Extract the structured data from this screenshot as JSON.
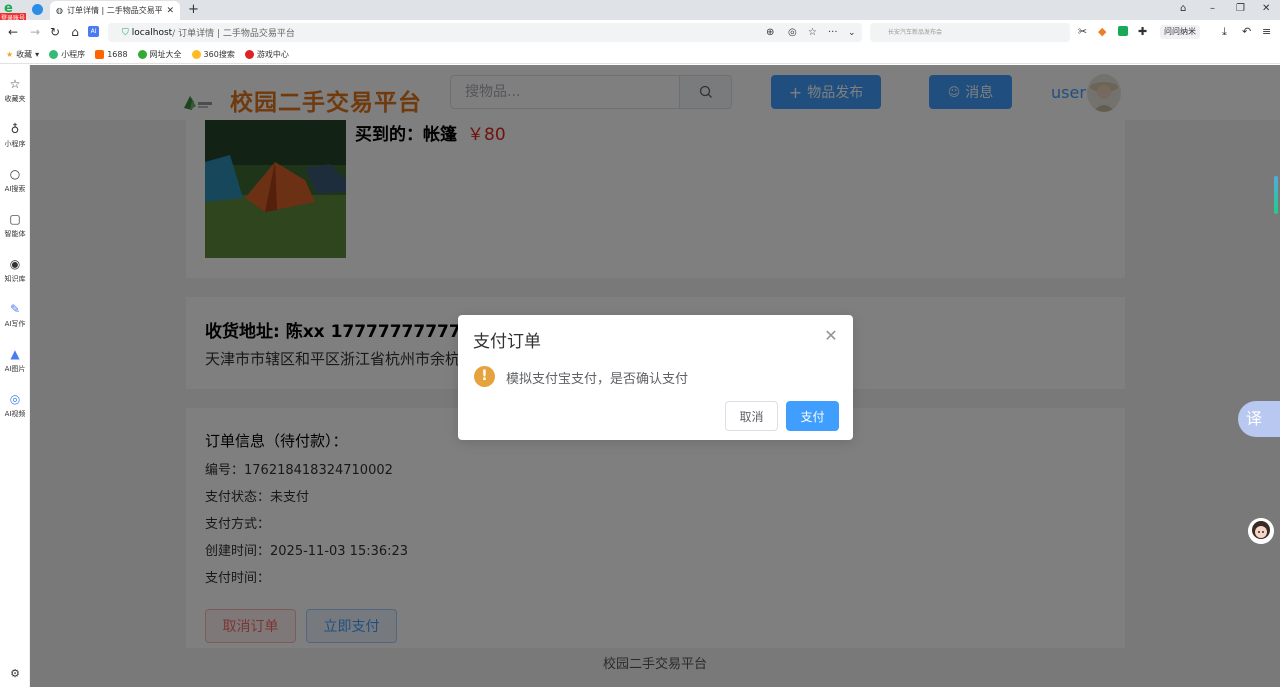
{
  "browser": {
    "badge": "登录账号",
    "tab_title": "订单详情 | 二手物品交易平台",
    "url_host": "localhost",
    "url_rest": " / 订单详情 | 二手物品交易平台",
    "search_hint": "长安汽车新品发布会",
    "ext_label": "问问纳米",
    "bookmarks": [
      "收藏",
      "小程序",
      "1688",
      "网址大全",
      "360搜索",
      "游戏中心"
    ]
  },
  "rail": {
    "items": [
      "收藏夹",
      "小程序",
      "AI搜索",
      "智能体",
      "知识库",
      "AI写作",
      "AI图片",
      "AI视频"
    ]
  },
  "header": {
    "site_title": "校园二手交易平台",
    "search_placeholder": "搜物品...",
    "publish_label": "物品发布",
    "message_label": "消息",
    "username": "user"
  },
  "product": {
    "bought_label": "买到的：帐篷",
    "price": "￥80"
  },
  "address": {
    "title": "收货地址: 陈xx 17777777777",
    "detail": "天津市市辖区和平区浙江省杭州市余杭区"
  },
  "order": {
    "title": "订单信息（待付款）：",
    "number": "编号：176218418324710002",
    "pay_status": "支付状态：未支付",
    "pay_method": "支付方式：",
    "created": "创建时间：2025-11-03 15:36:23",
    "pay_time": "支付时间：",
    "cancel_label": "取消订单",
    "pay_label": "立即支付"
  },
  "footer": "校园二手交易平台",
  "dialog": {
    "title": "支付订单",
    "message": "模拟支付宝支付，是否确认支付",
    "cancel_label": "取消",
    "confirm_label": "支付"
  },
  "translate_label": "译"
}
